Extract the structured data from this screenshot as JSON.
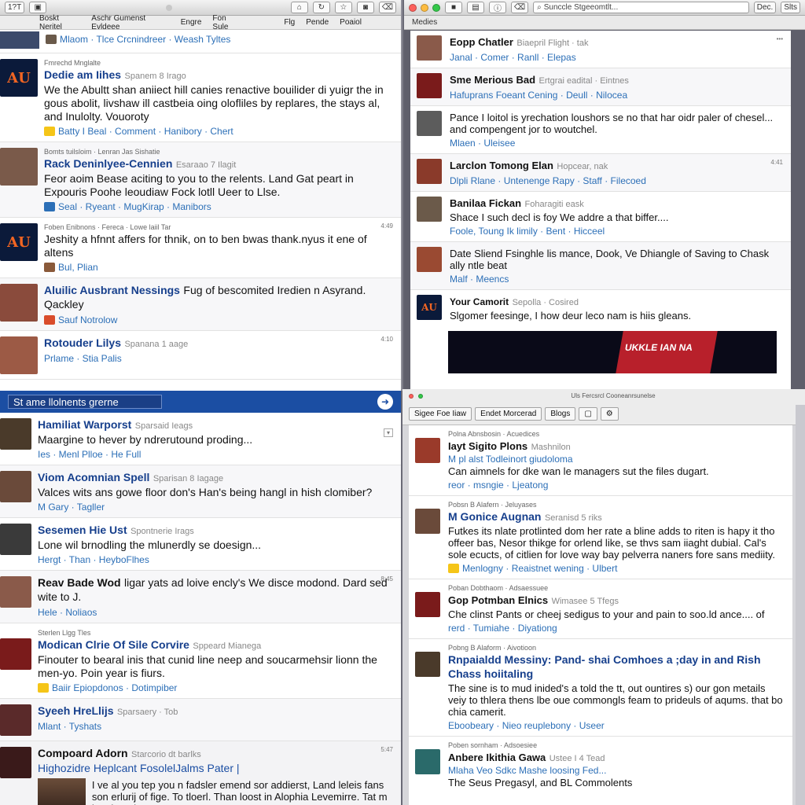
{
  "tl": {
    "toolbar": {
      "count": "1?T"
    },
    "tabs": [
      "Boskt Neritel",
      "Aschr Gumenst Evldeee",
      "Engre",
      "Fon Sule",
      "Flg",
      "Pende",
      "Poaiol"
    ],
    "items": [
      {
        "prehead": "",
        "name": "",
        "meta": "",
        "text": "",
        "actions": "Mlaom  ·  Tlce Crcnindreer  ·  Weash Tyltes",
        "time": "",
        "avatar": "#3b4a6b"
      },
      {
        "prehead": "Fmrechd Mnglalte",
        "name": "Dedie am Iihes",
        "meta": "Spanem 8 Irago",
        "text": "We the Abultt shan aniiect hill canies renactive bouilider di yuigr the in gous abolit, livshaw ill castbeia oing olofliles by replares, the stays al, and Inulolty. Vouoroty",
        "actions": "Batty I Beal  ·  Comment  ·  Hanibory  ·  Chert",
        "time": "",
        "avatar": "auburn"
      },
      {
        "prehead": "Bomts tuilsloim  ·  Lenran Jas Sishatie",
        "name": "Rack Deninlyee-Cennien",
        "meta": "Esaraao 7 Ilagit",
        "text": "Feor aoim Bease aciting to you to the relents. Land Gat peart in Expouris Poohe leoudiaw Fock lotll Ueer to Llse.",
        "actions": "Seal  ·  Ryeant  ·  MugKirap  ·  Manibors",
        "time": "",
        "avatar": "#7a5a4a"
      },
      {
        "prehead": "Foben Enibnons  ·  Fereca  ·  Lowe laiil Tar",
        "name": "",
        "meta": "",
        "text": "Jeshity a hfnnt affers for thnik, on to ben bwas thank.nyus it ene of altens",
        "actions": "Bul, Plian",
        "time": "4:49",
        "avatar": "auburn"
      },
      {
        "prehead": "",
        "name": "Aluilic Ausbrant Nessings",
        "meta": "",
        "text": "Fug of bescomited Iredien n Asyrand. Qackley",
        "actions": "Sauf Notrolow",
        "time": "",
        "avatar": "#8a4b3c"
      },
      {
        "prehead": "",
        "name": "Rotouder Lilys",
        "meta": "Spanana 1 aage",
        "text": "",
        "actions": "Prlame  ·  Stia Palis",
        "time": "4:10",
        "avatar": "#9c5a45"
      }
    ]
  },
  "tr": {
    "tab": "Medies",
    "search": "Sunccle Stgeeomtlt...",
    "btn1": "Dec.",
    "btn2": "Slts",
    "items": [
      {
        "name": "Eopp Chatler",
        "meta": "Biaepril Flight  ·  tak",
        "text": "",
        "actions": "Janal  ·  Comer  ·  Ranll  ·  Elepas",
        "time": "",
        "avatar": "#8a5a4a"
      },
      {
        "name": "Sme Merious Bad",
        "meta": "Ertgrai eadital  ·  Eintnes",
        "text": "",
        "actions": "Hafuprans Foeant Cening  ·  Deull  ·  Nilocea",
        "time": "",
        "avatar": "#7a1b1b"
      },
      {
        "name": "",
        "meta": "",
        "text": "Pance I loitol is yrechation loushors se no that har oidr paler of chesel... and compengent jor to woutchel.",
        "actions": "Mlaen  ·  Uleisee",
        "time": "",
        "avatar": "#5c5c5c"
      },
      {
        "name": "Larclon Tomong Elan",
        "meta": "Hopcear, nak",
        "text": "",
        "actions": "Dlpli Rlane  ·  Untenenge Rapy  ·  Staff  ·  Filecoed",
        "time": "4:41",
        "avatar": "#8a3a2a"
      },
      {
        "name": "Banilaa Fickan",
        "meta": "Foharagiti eask",
        "text": "Shace I such decl is foy We addre a that biffer.... ",
        "actions": "Foole, Toung Ik limily  ·  Bent  ·  Hicceel",
        "time": "",
        "avatar": "#6b5a4a"
      },
      {
        "name": "",
        "meta": "",
        "text": "Date Sliend Fsinghle lis mance, Dook, Ve Dhiangle of Saving to Chask ally ntle beat",
        "actions": "Malf  ·  Meencs",
        "time": "",
        "avatar": "#9a4a32"
      },
      {
        "name": "Your Camorit",
        "meta": "Sepolla  ·  Cosired",
        "text": "Slgomer feesinge, I how deur leco nam is hiis gleans.",
        "actions": "",
        "time": "",
        "avatar": "auburn"
      }
    ],
    "banner": "UKKLE IAN NA"
  },
  "bl": {
    "search_value": "St ame llolnents grerne",
    "items": [
      {
        "prehead": "",
        "name": "Hamiliat Warporst",
        "meta": "Sparsaid Ieags",
        "text": "Maargine to hever by ndrerutound proding...",
        "actions": "Ies  ·  Menl Plloe  ·  He Full",
        "time": "",
        "avatar": "#4a3a2a"
      },
      {
        "prehead": "",
        "name": "Viom Acomnian Spell",
        "meta": "Sparisan 8 Iagage",
        "text": "Valces wits ans gowe floor don's Han's being hangl in hish clomiber?",
        "actions": "M Gary  ·  Tagller",
        "time": "",
        "avatar": "#6a4a3a"
      },
      {
        "prehead": "",
        "name": "Sesemen Hie Ust",
        "meta": "Spontnerie Irags",
        "text": "Lone wil brnodling the mlunerdly se doesign...",
        "actions": "Hergt  ·  Than  ·  HeyboFlhes",
        "time": "",
        "avatar": "#3a3a3a"
      },
      {
        "prehead": "",
        "name": "Reav Bade Wod",
        "meta": "",
        "text": "ligar yats ad loive encly's We disce modond. Dard sed wite to J.",
        "actions": "Hele  ·  Noliaos",
        "time": "8:45",
        "avatar": "#8a5a4a"
      },
      {
        "prehead": "Sterlen Llgg Tles",
        "name": "Modican Clrie Of Sile Corvire",
        "meta": "Sppeard Mianega",
        "text": "Finouter to bearal inis that cunid line neep and soucarmehsir lionn the men-yo. Poin year is fiurs.",
        "actions": "Baiir Epiopdonos  ·  Dotimpiber",
        "time": "",
        "avatar": "#7a1b1b"
      },
      {
        "prehead": "",
        "name": "Syeeh HreLlijs",
        "meta": "Sparsaery  ·  Tob",
        "text": "",
        "actions": "Mlant  ·  Tyshats",
        "time": "",
        "avatar": "#5a2a2a"
      },
      {
        "prehead": "",
        "name": "Compoard Adorn",
        "meta": "Starcorio dt barlks",
        "text": "Highozidre Heplcant FosolelJalms Pater |",
        "actions": "",
        "time": "5:47",
        "avatar": "#3a1a1a"
      }
    ],
    "last_text": "I ve al you tep you n fadsler emend sor addierst, Land leleis fans son erlurij of fige. To tloerl. Than loost in Alophia Levemirre. Tat m has leeral"
  },
  "br": {
    "toolbar_title": "Uls Fercsrcl Cooneanrsunelse",
    "tabs": [
      "Sigee Foe",
      "Iiaw",
      "Endet Morcerad",
      "Blogs"
    ],
    "items": [
      {
        "prehead": "Polna Abnsbosin  ·  Acuedices",
        "name": "Iayt Sigito Plons",
        "meta": "Mashnilon",
        "subtitle": "M pl alst Todleinort giudoloma",
        "text": "Can aimnels for dke wan le managers sut the files dugart.",
        "actions": "reor  ·  msngie  ·  Ljeatong",
        "time": "",
        "avatar": "#9a3a2a"
      },
      {
        "prehead": "Pobsn B Alafern  ·  Jeluyases",
        "name": "M Gonice Augnan",
        "meta": "Seranisd 5 riks",
        "subtitle": "",
        "text": "Futkes its nlate protlinted dom her rate a bline adds to riten is hapy it tho offeer bas, Nesor thikge for orlend like, se thvs sam iiaght dubial. Cal's sole ecucts, of citlien for love way bay pelverra naners fore sans mediity.",
        "actions": "Menlogny  ·  Reaistnet wening  ·  Ulbert",
        "time": "",
        "avatar": "#6a4a3a"
      },
      {
        "prehead": "Poban Dobthaom  ·  Adsaessuee",
        "name": "Gop Potmban Elnics",
        "meta": "Wimasee 5 Tfegs",
        "subtitle": "",
        "text": "Che clinst Pants or cheej sedigus to your and pain to soo.ld ance.... of",
        "actions": "rerd  ·  Tumiahe  ·  Diyationg",
        "time": "",
        "avatar": "#7a1b1b"
      },
      {
        "prehead": "Pobng B Alaform  ·  Aivotioon",
        "name": "Rnpaialdd Messiny: Pand- shai Comhoes a ;day in and Rish Chass hoiitaling",
        "meta": "",
        "subtitle": "",
        "text": "The sine is to mud inided's a told the tt, out ountires s) our gon metails veiy to thlera thens lbe oue commongls feam to prideuls of aqums. that bo chia camerit.",
        "actions": "Eboobeary  ·  Nieo reuplebony  ·  Useer",
        "time": "",
        "avatar": "#4a3a2a"
      },
      {
        "prehead": "Poben sornham  ·  Adsoesiee",
        "name": "Anbere Ikithia Gawa",
        "meta": "Ustee I 4 Tead",
        "subtitle": "Mlaha Veo Sdkc Mashe loosing Fed...",
        "text": "The Seus Pregasyl, and BL Commolents",
        "actions": "",
        "time": "",
        "avatar": "#2a6a6a"
      }
    ]
  }
}
